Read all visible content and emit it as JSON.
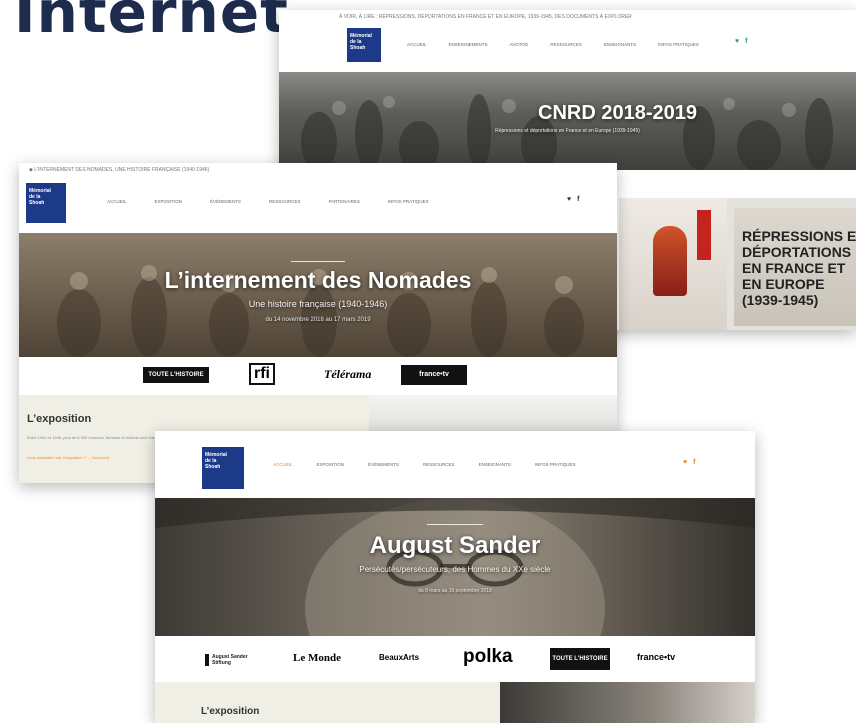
{
  "heading": "Internet",
  "cnrd": {
    "topbar": "À VOIR, À LIRE : RÉPRESSIONS, DÉPORTATIONS EN FRANCE ET EN EUROPE, 1939-1945, DES DOCUMENTS À EXPLORER",
    "logo": [
      "Mémorial",
      "de la",
      "Shoah"
    ],
    "menu": [
      "ACCUEIL",
      "ENSEIGNEMENTS",
      "AVOTOG",
      "RESSOURCES",
      "ENSEIGNANTS",
      "INFOS PRATIQUES"
    ],
    "social": [
      "♥",
      "f"
    ],
    "hero_title": "CNRD 2018-2019",
    "hero_sub": "Répressions et déportations en France et en Europe (1939-1945)",
    "poster_text": [
      "RÉPRESSIONS E",
      "DÉPORTATIONS",
      "EN FRANCE ET",
      "EN EUROPE",
      "(1939-1945)"
    ]
  },
  "nomades": {
    "topbar": "◆ L'INTERNEMENT DES NOMADES, UNE HISTOIRE FRANÇAISE (1940-1946)",
    "logo": [
      "Mémorial",
      "de la",
      "Shoah"
    ],
    "menu": [
      "ACCUEIL",
      "EXPOSITION",
      "ÉVÉNEMENTS",
      "RESSOURCES",
      "PARTENAIRES",
      "INFOS PRATIQUES"
    ],
    "social": [
      "♥",
      "f"
    ],
    "hero_title": "L’internement des Nomades",
    "hero_sub": "Une histoire française (1940-1946)",
    "hero_date": "du 14 novembre 2018 au 17 mars 2019",
    "partners": [
      "TOUTE L'HISTOIRE",
      "rfi",
      "Télérama",
      "france•tv"
    ],
    "section_title": "L’exposition",
    "para": "Entre 1940 et 1946, plus de 6 500 hommes, femmes et enfants sont internés en France dans une trentaine de camps…",
    "link": "Vous souhaitez voir l’exposition ? → Découvrir"
  },
  "sander": {
    "logo": [
      "Mémorial",
      "de la",
      "Shoah"
    ],
    "menu": [
      "ACCUEIL",
      "EXPOSITION",
      "ÉVÉNEMENTS",
      "RESSOURCES",
      "ENSEIGNANTS",
      "INFOS PRATIQUES"
    ],
    "social": [
      "♥",
      "f"
    ],
    "hero_title": "August Sander",
    "hero_sub": "Persécutés/persécuteurs, des Hommes du XXe siècle",
    "hero_date": "du 8 mars au 15 septembre 2018",
    "partners": [
      "August Sander Stiftung",
      "Le Monde",
      "BeauxArts",
      "polka",
      "TOUTE L'HISTOIRE",
      "france•tv"
    ],
    "section_title": "L’exposition"
  },
  "colors": {
    "brand_blue": "#1c3a87",
    "accent_orange": "#e88b1c",
    "heading_navy": "#1d2b4c"
  }
}
